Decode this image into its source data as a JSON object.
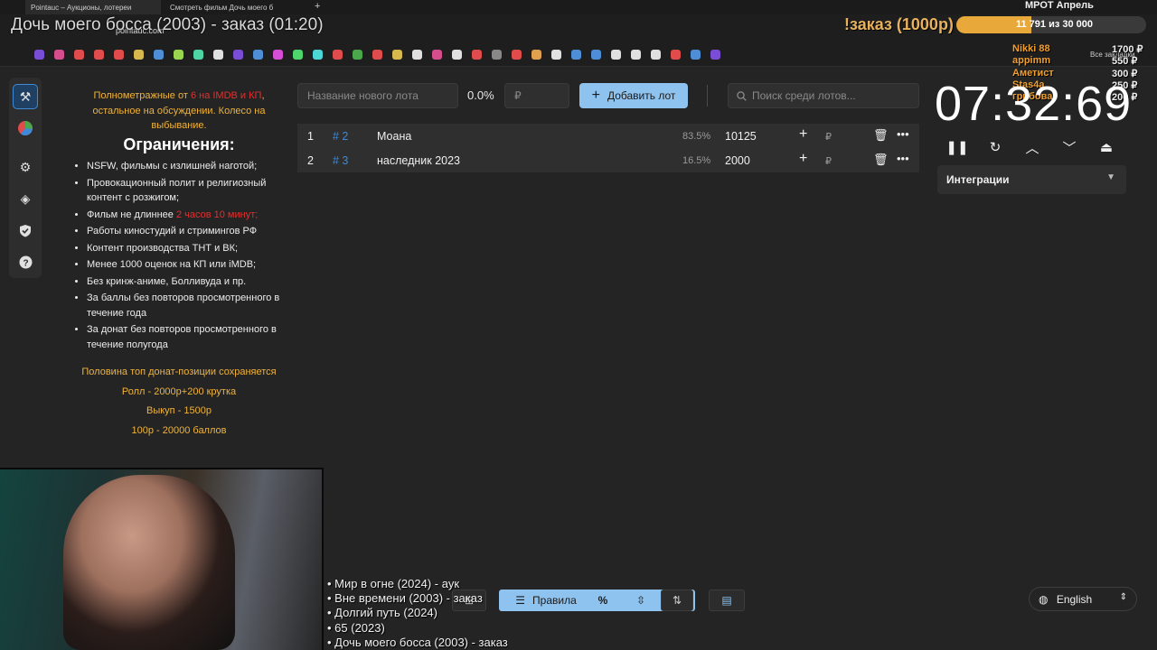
{
  "browser": {
    "tabs": [
      {
        "label": "Pointauc – Аукционы, лотереи"
      },
      {
        "label": "Смотреть фильм Дочь моего б"
      }
    ],
    "url": "pointauc.com",
    "all_bookmarks": "Все закладки"
  },
  "overlay": {
    "title": "Дочь моего босса (2003) - заказ (01:20)",
    "order": "!заказ (1000р)",
    "mrot": {
      "label": "МРОТ Апрель",
      "text": "11 791 из 30 000",
      "progress": 0.393
    },
    "donors": [
      {
        "name": "Nikki 88",
        "amount": "1700 ₽"
      },
      {
        "name": "appimm",
        "amount": "550 ₽"
      },
      {
        "name": "Аметист",
        "amount": "300 ₽"
      },
      {
        "name": "Stas4a",
        "amount": "250 ₽"
      },
      {
        "name": "грибова",
        "amount": "200 ₽"
      }
    ]
  },
  "sidebar": {
    "items": [
      {
        "icon": "gavel-icon"
      },
      {
        "icon": "wheel-icon"
      },
      {
        "icon": "gear-icon"
      },
      {
        "icon": "layers-icon"
      },
      {
        "icon": "shield-icon"
      },
      {
        "icon": "help-icon"
      }
    ]
  },
  "rules": {
    "intro_a": "Полнометражные от ",
    "intro_b": "6 на IMDB и КП",
    "intro_c": ", остальное на обсуждении. Колесо на выбывание.",
    "heading": "Ограничения:",
    "items": [
      "NSFW, фильмы с излишней наготой;",
      "Провокационный полит и религиозный контент с розжигом;",
      "Работы киностудий и стримингов РФ",
      "Контент производства ТНТ и ВК;",
      "Менее 1000 оценок на КП или iMDB;",
      "Без кринж-аниме, Болливуда и пр.",
      "За баллы без повторов просмотренного в течение года",
      "За донат без повторов просмотренного в течение полугода"
    ],
    "duration_a": "Фильм не длиннее ",
    "duration_b": "2 часов 10 минут;",
    "promo": [
      "Половина топ донат-позиции сохраняется",
      "Ролл - 2000р+200 крутка",
      "Выкуп - 1500р",
      "100р - 20000 баллов"
    ]
  },
  "toolbar": {
    "lot_placeholder": "Название нового лота",
    "percent": "0.0%",
    "amount_placeholder": "₽",
    "add_label": "Добавить лот",
    "search_placeholder": "Поиск среди лотов..."
  },
  "lots": [
    {
      "index": "1",
      "id": "# 2",
      "name": "Моана",
      "percent": "83.5%",
      "amount": "10125",
      "currency": "₽"
    },
    {
      "index": "2",
      "id": "# 3",
      "name": "наследник 2023",
      "percent": "16.5%",
      "amount": "2000",
      "currency": "₽"
    }
  ],
  "timer": {
    "value": "07:32:69"
  },
  "integrations": {
    "label": "Интеграции"
  },
  "history": [
    "• Мир в огне (2024) - аук",
    "• Вне времени (2003) - заказ",
    "• Долгий путь (2024)",
    "• 65 (2023)",
    "• Дочь моего босса (2003) - заказ"
  ],
  "bottombar": {
    "rules_label": "Правила"
  },
  "language": {
    "selected": "English"
  },
  "colors": {
    "accent": "#8ec3ef",
    "orange": "#f0b33b",
    "red": "#e03030",
    "id_blue": "#3e8ad6",
    "background": "#242424"
  }
}
